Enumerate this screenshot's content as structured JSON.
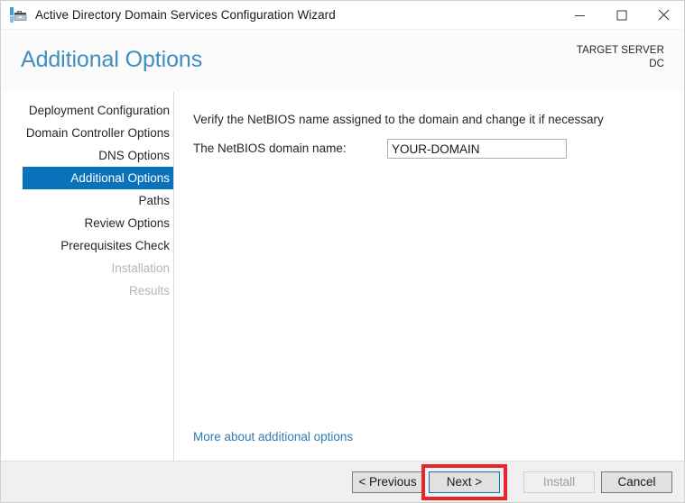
{
  "window": {
    "title": "Active Directory Domain Services Configuration Wizard",
    "icon": "server-wizard-icon",
    "controls": {
      "minimize_label": "Minimize",
      "maximize_label": "Maximize",
      "close_label": "Close"
    }
  },
  "header": {
    "page_title": "Additional Options",
    "target_server_label": "TARGET SERVER",
    "target_server_value": "DC",
    "accent_color": "#3f8ebd"
  },
  "sidebar": {
    "items": [
      {
        "label": "Deployment Configuration",
        "state": "enabled"
      },
      {
        "label": "Domain Controller Options",
        "state": "enabled"
      },
      {
        "label": "DNS Options",
        "state": "enabled"
      },
      {
        "label": "Additional Options",
        "state": "selected"
      },
      {
        "label": "Paths",
        "state": "enabled"
      },
      {
        "label": "Review Options",
        "state": "enabled"
      },
      {
        "label": "Prerequisites Check",
        "state": "enabled"
      },
      {
        "label": "Installation",
        "state": "disabled"
      },
      {
        "label": "Results",
        "state": "disabled"
      }
    ],
    "selected_color": "#0a72bb"
  },
  "main": {
    "instruction": "Verify the NetBIOS name assigned to the domain and change it if necessary",
    "netbios_label": "The NetBIOS domain name:",
    "netbios_value": "YOUR-DOMAIN",
    "netbios_placeholder": "",
    "more_link": "More about additional options"
  },
  "footer": {
    "previous_label": "< Previous",
    "next_label": "Next >",
    "install_label": "Install",
    "cancel_label": "Cancel",
    "next_state": "focused",
    "install_state": "disabled"
  },
  "annotation": {
    "highlight_target": "Next >",
    "highlight_color": "#e8252a"
  }
}
